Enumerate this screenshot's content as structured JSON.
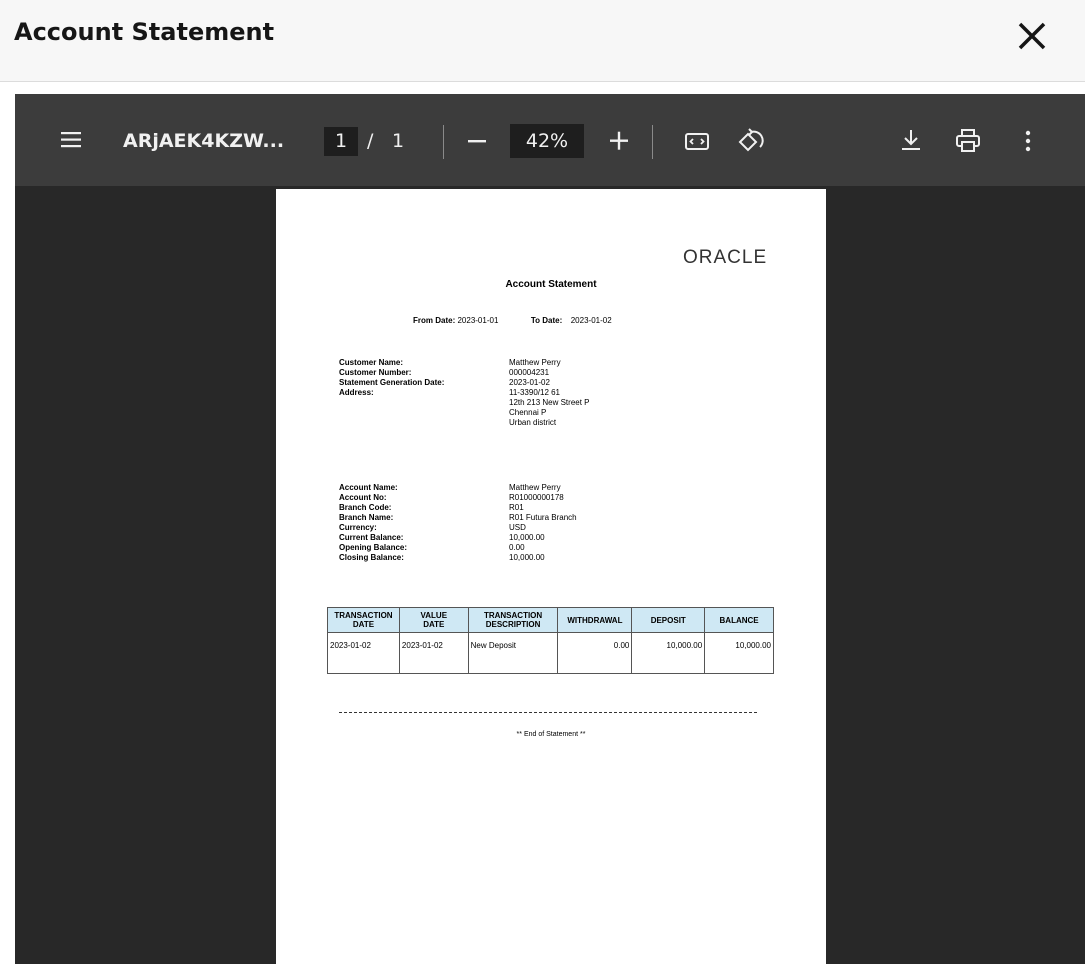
{
  "dialog": {
    "title": "Account Statement"
  },
  "toolbar": {
    "menu_icon": "hamburger-menu-icon",
    "document_name": "ARjAEK4KZW...",
    "current_page": "1",
    "page_separator": "/",
    "total_pages": "1",
    "zoom_out_icon": "minus-icon",
    "zoom_level": "42%",
    "zoom_in_icon": "plus-icon",
    "fit_icon": "fit-to-page-icon",
    "rotate_icon": "rotate-icon",
    "download_icon": "download-icon",
    "print_icon": "print-icon",
    "more_icon": "more-vertical-icon"
  },
  "document": {
    "logo": "ORACLE",
    "title": "Account Statement",
    "from_date_label": "From Date:",
    "from_date": "2023-01-01",
    "to_date_label": "To Date:",
    "to_date": "2023-01-02",
    "customer": [
      {
        "label": "Customer Name:",
        "value": "Matthew Perry"
      },
      {
        "label": "Customer Number:",
        "value": "000004231"
      },
      {
        "label": "Statement Generation Date:",
        "value": "2023-01-02"
      },
      {
        "label": "Address:",
        "value": "11-3390/12 61"
      }
    ],
    "address_lines": [
      "12th 213 New Street P",
      "Chennai P",
      "Urban district"
    ],
    "account": [
      {
        "label": "Account Name:",
        "value": "Matthew Perry"
      },
      {
        "label": "Account No:",
        "value": "R01000000178"
      },
      {
        "label": "Branch Code:",
        "value": "R01"
      },
      {
        "label": "Branch Name:",
        "value": "R01 Futura Branch"
      },
      {
        "label": "Currency:",
        "value": "USD"
      },
      {
        "label": "Current Balance:",
        "value": "10,000.00"
      },
      {
        "label": "Opening Balance:",
        "value": "0.00"
      },
      {
        "label": "Closing Balance:",
        "value": "10,000.00"
      }
    ],
    "table": {
      "headers": [
        [
          "TRANSACTION",
          "DATE"
        ],
        [
          "VALUE",
          "DATE"
        ],
        [
          "TRANSACTION",
          "DESCRIPTION"
        ],
        [
          "WITHDRAWAL",
          ""
        ],
        [
          "DEPOSIT",
          ""
        ],
        [
          "BALANCE",
          ""
        ]
      ],
      "rows": [
        [
          "2023-01-02",
          "2023-01-02",
          "New Deposit",
          "0.00",
          "10,000.00",
          "10,000.00"
        ]
      ]
    },
    "end_text": "** End of Statement **"
  }
}
